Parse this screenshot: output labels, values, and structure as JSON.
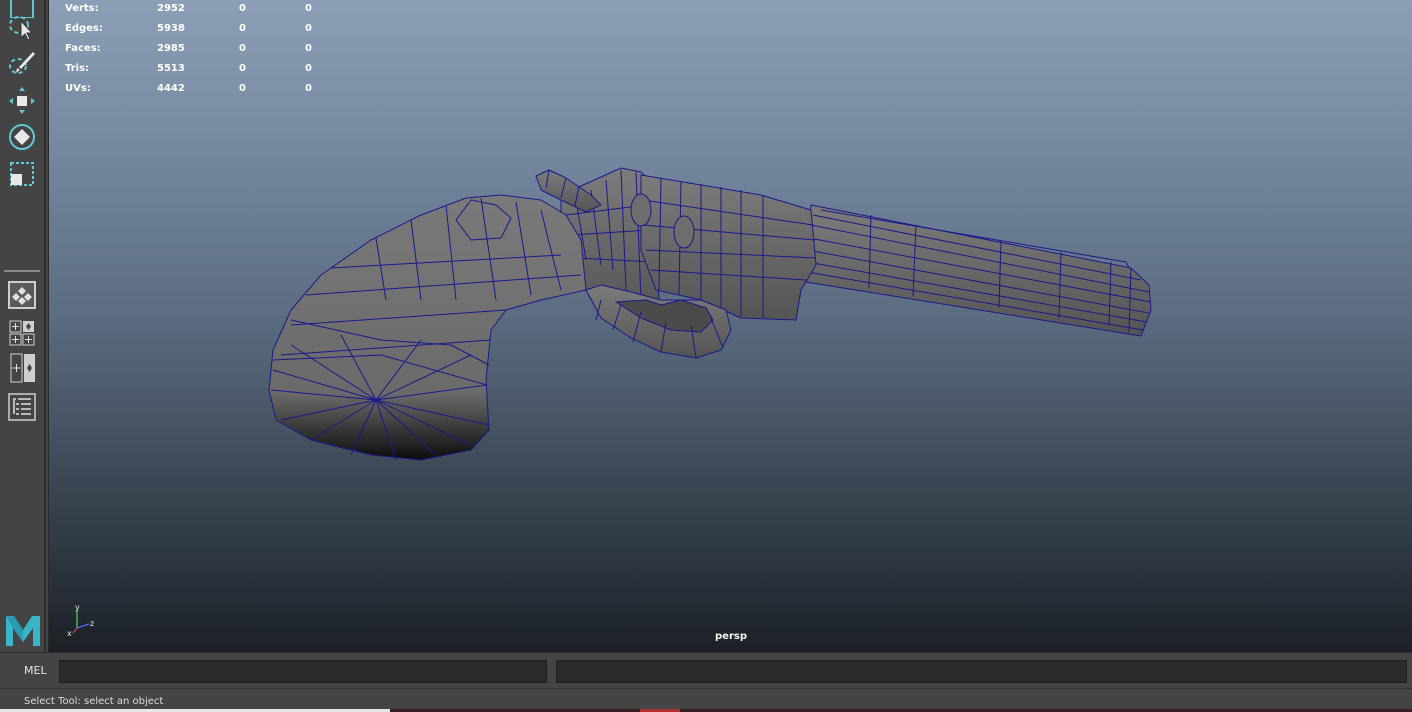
{
  "stats": {
    "rows": [
      {
        "label": "Verts:",
        "values": [
          "2952",
          "0",
          "0"
        ]
      },
      {
        "label": "Edges:",
        "values": [
          "5938",
          "0",
          "0"
        ]
      },
      {
        "label": "Faces:",
        "values": [
          "2985",
          "0",
          "0"
        ]
      },
      {
        "label": "Tris:",
        "values": [
          "5513",
          "0",
          "0"
        ]
      },
      {
        "label": "UVs:",
        "values": [
          "4442",
          "0",
          "0"
        ]
      }
    ]
  },
  "viewport": {
    "camera_label": "persp",
    "background_top": "#8c9fb6",
    "background_bottom": "#1b2026",
    "wire_color": "#1a1a8c",
    "mesh_color": "#6f6f6f"
  },
  "toolbox": {
    "tools": [
      "select-tool-icon",
      "lasso-tool-icon",
      "paint-select-icon",
      "move-tool-icon",
      "rotate-tool-icon",
      "scale-tool-icon",
      "single-view-icon",
      "four-view-icon",
      "two-view-icon",
      "outliner-icon"
    ],
    "accent": "#5fc8d6"
  },
  "command_line": {
    "label": "MEL",
    "input_value": ""
  },
  "help_line": {
    "text": "Select Tool: select an object"
  },
  "axis": {
    "x": "x",
    "y": "y",
    "z": "z"
  }
}
